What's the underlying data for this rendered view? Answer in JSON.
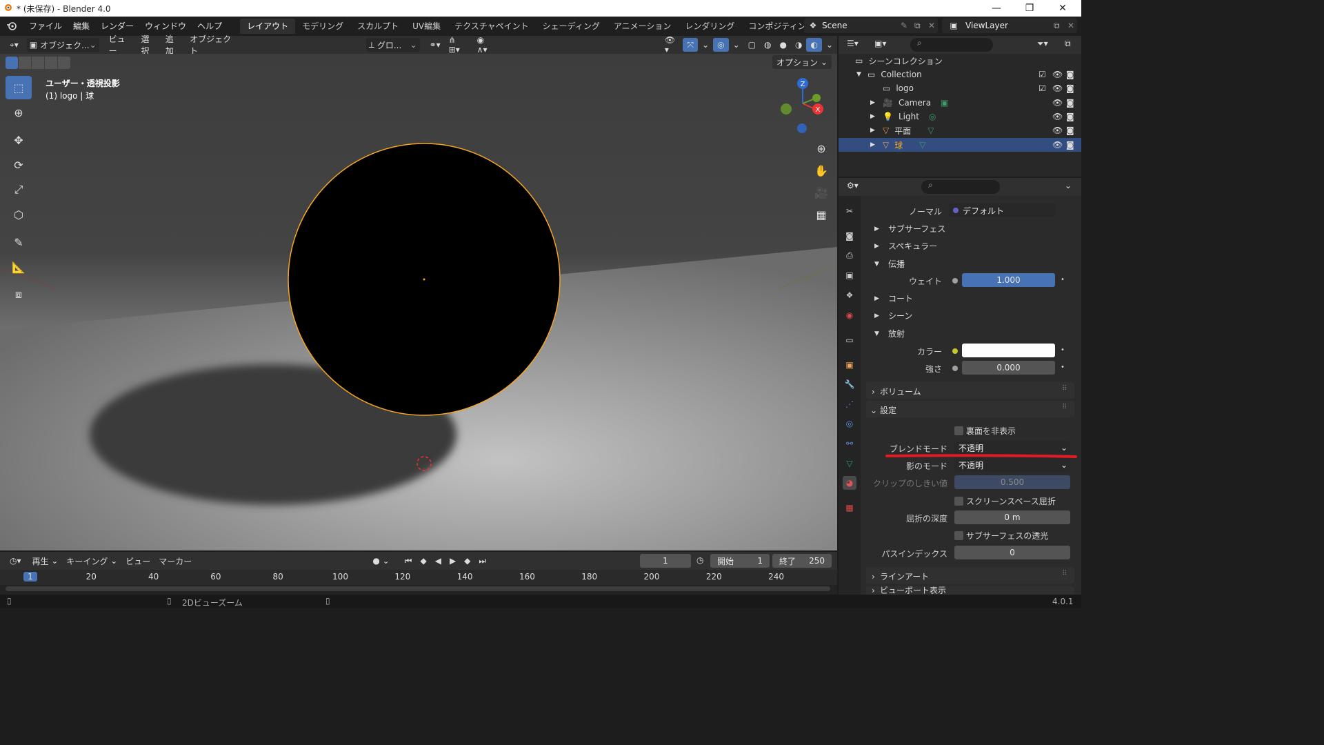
{
  "window": {
    "title": "* (未保存) - Blender 4.0",
    "minimize": "—",
    "maximize": "❐",
    "close": "✕"
  },
  "menu": {
    "items": [
      "ファイル",
      "編集",
      "レンダー",
      "ウィンドウ",
      "ヘルプ"
    ]
  },
  "workspaces": [
    "レイアウト",
    "モデリング",
    "スカルプト",
    "UV編集",
    "テクスチャペイント",
    "シェーディング",
    "アニメーション",
    "レンダリング",
    "コンポジティング"
  ],
  "scene": {
    "name": "Scene",
    "view_layer": "ViewLayer"
  },
  "viewport_header": {
    "mode": "オブジェク...",
    "menus": [
      "ビュー",
      "選択",
      "追加",
      "オブジェクト"
    ],
    "transform_orientation": "グロ...",
    "options_label": "オプション"
  },
  "viewport": {
    "view_name": "ユーザー・透視投影",
    "object_info": "(1) logo | 球",
    "gizmo_axes": [
      "Z",
      "X"
    ]
  },
  "outliner": {
    "root": "シーンコレクション",
    "collection": "Collection",
    "items": [
      {
        "name": "logo",
        "color": "#dddddd"
      },
      {
        "name": "Camera",
        "color": "#dddddd"
      },
      {
        "name": "Light",
        "color": "#dddddd"
      },
      {
        "name": "平面",
        "color": "#dddddd"
      },
      {
        "name": "球",
        "color": "#f5a623"
      }
    ]
  },
  "properties": {
    "normal_label": "ノーマル",
    "normal_value": "デフォルト",
    "subsurface": "サブサーフェス",
    "specular": "スペキュラー",
    "transmission": "伝播",
    "weight_label": "ウェイト",
    "weight_value": "1.000",
    "coat": "コート",
    "sheen": "シーン",
    "emission": "放射",
    "color_label": "カラー",
    "strength_label": "強さ",
    "strength_value": "0.000",
    "volume_panel": "ボリューム",
    "settings_panel": "設定",
    "backface_label": "裏面を非表示",
    "blend_mode_label": "ブレンドモード",
    "blend_mode_value": "不透明",
    "shadow_mode_label": "影のモード",
    "shadow_mode_value": "不透明",
    "clip_label": "クリップのしきい値",
    "clip_value": "0.500",
    "ssr_label": "スクリーンスペース屈折",
    "refraction_depth_label": "屈折の深度",
    "refraction_depth_value": "0 m",
    "subsurface_translucency_label": "サブサーフェスの透光",
    "pass_index_label": "パスインデックス",
    "pass_index_value": "0",
    "lineart_panel": "ラインアート",
    "viewport_display_panel": "ビューポート表示",
    "highlight_color": "#e01b24"
  },
  "timeline": {
    "menus": [
      "再生",
      "キーイング",
      "ビュー",
      "マーカー"
    ],
    "current_frame": "1",
    "start_label": "開始",
    "start_value": "1",
    "end_label": "終了",
    "end_value": "250",
    "ticks": [
      "1",
      "20",
      "40",
      "60",
      "80",
      "100",
      "120",
      "140",
      "160",
      "180",
      "200",
      "220",
      "240"
    ]
  },
  "status": {
    "hint": "2Dビューズーム",
    "version": "4.0.1"
  },
  "colors": {
    "accent": "#4772b3",
    "selected_outline": "#f5a623",
    "panel": "#303030"
  }
}
